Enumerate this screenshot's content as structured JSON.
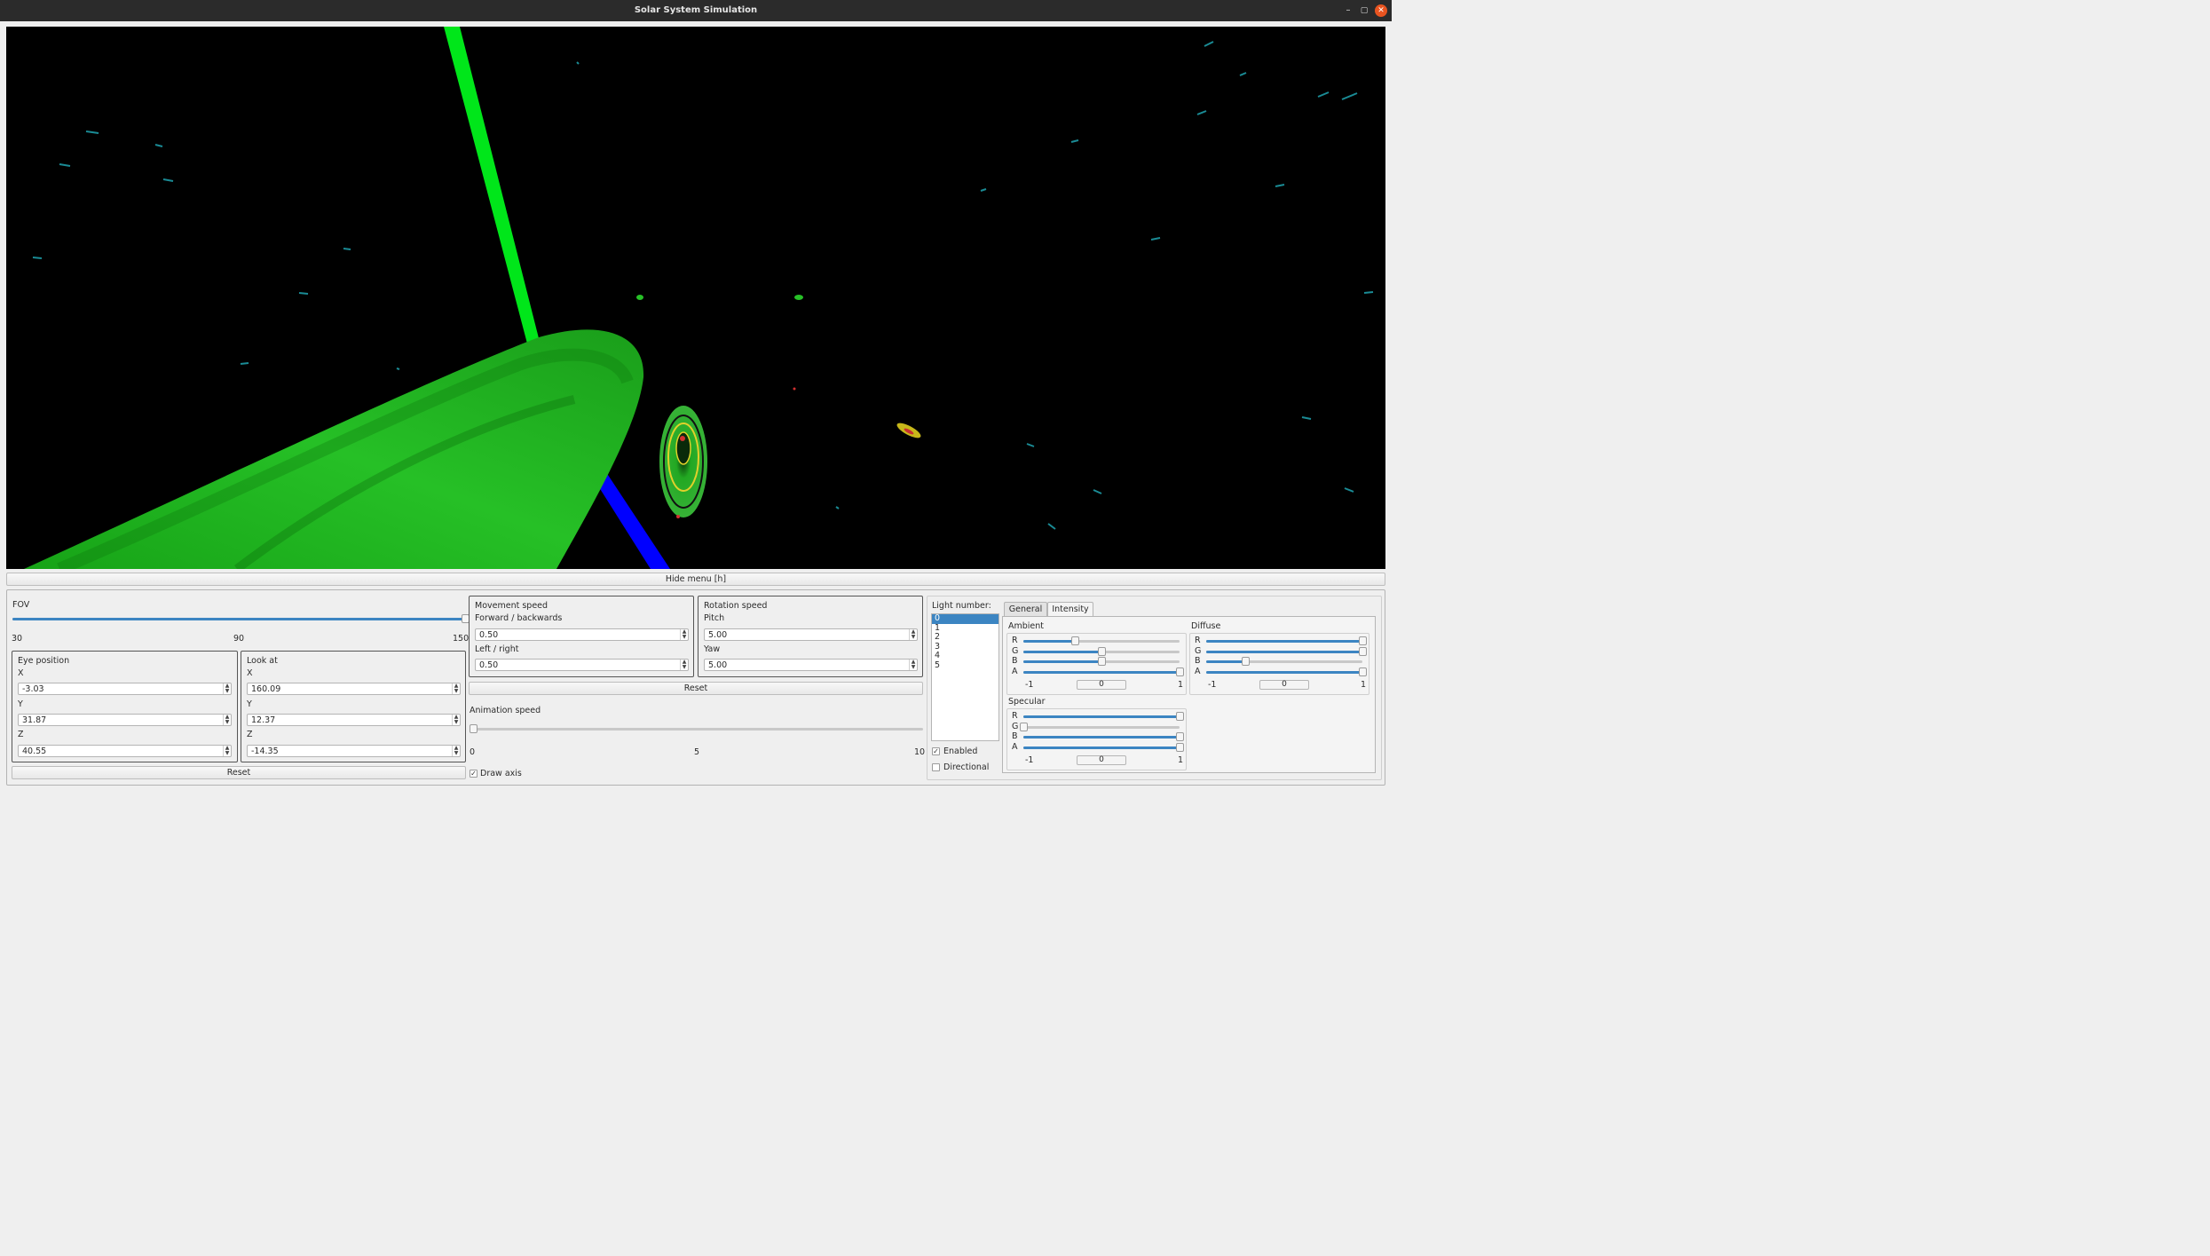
{
  "window": {
    "title": "Solar System Simulation"
  },
  "hide_menu_label": "Hide menu [h]",
  "fov": {
    "label": "FOV",
    "min_label": "30",
    "mid_label": "90",
    "max_label": "150",
    "value": 150,
    "min": 30,
    "max": 150
  },
  "eye": {
    "title": "Eye position",
    "x_label": "X",
    "x": "-3.03",
    "y_label": "Y",
    "y": "31.87",
    "z_label": "Z",
    "z": "40.55"
  },
  "look": {
    "title": "Look at",
    "x_label": "X",
    "x": "160.09",
    "y_label": "Y",
    "y": "12.37",
    "z_label": "Z",
    "z": "-14.35"
  },
  "camera_reset_label": "Reset",
  "movement": {
    "title": "Movement speed",
    "fb_label": "Forward / backwards",
    "fb": "0.50",
    "lr_label": "Left / right",
    "lr": "0.50"
  },
  "rotation": {
    "title": "Rotation speed",
    "pitch_label": "Pitch",
    "pitch": "5.00",
    "yaw_label": "Yaw",
    "yaw": "5.00"
  },
  "speed_reset_label": "Reset",
  "animation": {
    "label": "Animation speed",
    "min_label": "0",
    "mid_label": "5",
    "max_label": "10",
    "value": 0
  },
  "draw_axis": {
    "label": "Draw axis",
    "checked": true
  },
  "light": {
    "number_label": "Light number:",
    "items": [
      "0",
      "1",
      "2",
      "3",
      "4",
      "5"
    ],
    "selected": "0",
    "enabled_label": "Enabled",
    "enabled": true,
    "directional_label": "Directional",
    "directional": false
  },
  "tabs": {
    "general": "General",
    "intensity": "Intensity",
    "active": "Intensity"
  },
  "intensity": {
    "ambient": {
      "title": "Ambient",
      "r": 0.33,
      "g": 0.5,
      "b": 0.5,
      "a": 1.0,
      "min_label": "-1",
      "max_label": "1",
      "zero_label": "0"
    },
    "diffuse": {
      "title": "Diffuse",
      "r": 1.0,
      "g": 1.0,
      "b": 0.25,
      "a": 1.0,
      "min_label": "-1",
      "max_label": "1",
      "zero_label": "0"
    },
    "specular": {
      "title": "Specular",
      "r": 1.0,
      "g": 0.0,
      "b": 1.0,
      "a": 1.0,
      "min_label": "-1",
      "max_label": "1",
      "zero_label": "0"
    },
    "channels": [
      "R",
      "G",
      "B",
      "A"
    ]
  },
  "colors": {
    "axis_green": "#00e61a",
    "axis_blue": "#0000ff",
    "planet_green": "#1fb31f",
    "accent": "#3c85c2",
    "close_button": "#e95420"
  }
}
